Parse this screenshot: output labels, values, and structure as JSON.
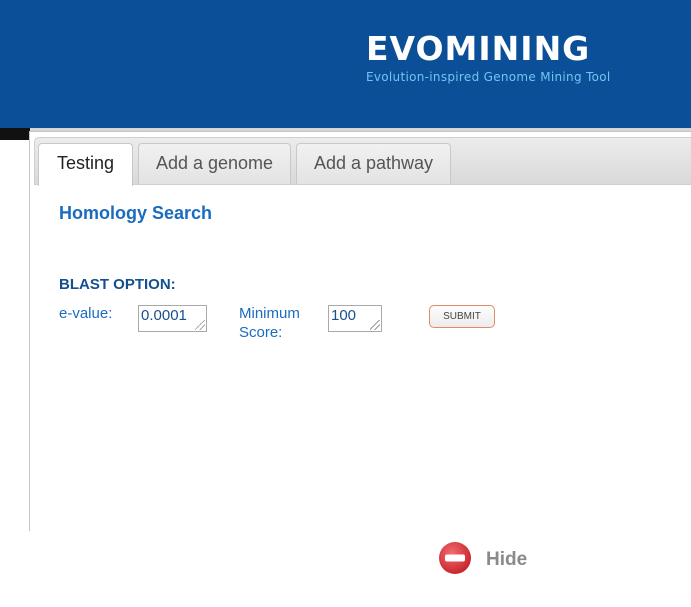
{
  "header": {
    "title": "EVOMINING",
    "subtitle": "Evolution-inspired Genome Mining Tool",
    "background_color": "#0b4f99"
  },
  "tabs": [
    {
      "label": "Testing",
      "active": true
    },
    {
      "label": "Add a genome",
      "active": false
    },
    {
      "label": "Add a pathway",
      "active": false
    }
  ],
  "content": {
    "title": "Homology Search",
    "blast_option_label": "BLAST OPTION:",
    "evalue": {
      "label": "e-value:",
      "value": "0.0001"
    },
    "min_score": {
      "label_line1": "Minimum",
      "label_line2": "Score:",
      "value": "100"
    },
    "submit_label": "SUBMIT"
  },
  "footer": {
    "hide_label": "Hide",
    "hide_icon": "minus-circle-icon",
    "hide_icon_color": "#d9363e"
  }
}
